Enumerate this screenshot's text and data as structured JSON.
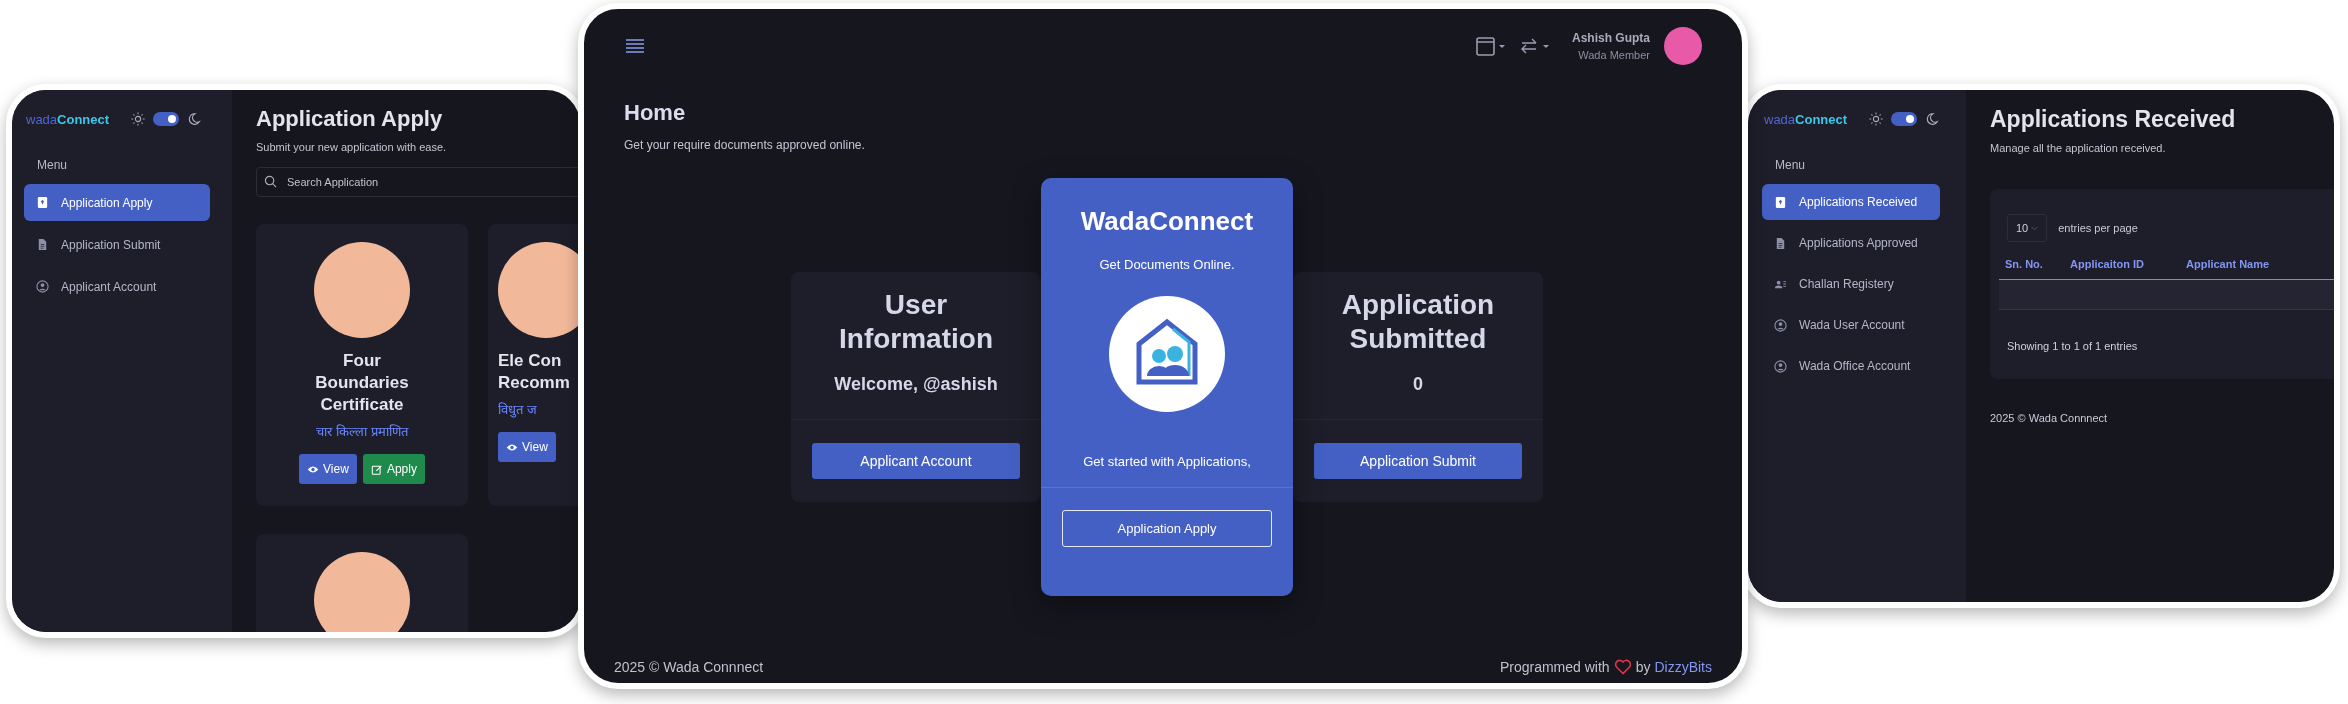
{
  "apply_screen": {
    "logo": {
      "prefix": "wada",
      "name": "Connect"
    },
    "theme_toggle": {
      "on": true
    },
    "menu_label": "Menu",
    "sidebar": {
      "items": [
        {
          "kind": "upload",
          "label": "Application Apply",
          "selected": true
        },
        {
          "kind": "document",
          "label": "Application Submit",
          "selected": false
        },
        {
          "kind": "account",
          "label": "Applicant Account",
          "selected": false
        }
      ]
    },
    "title": "Application Apply",
    "subtitle": "Submit your new application with ease.",
    "search": {
      "placeholder": "Search Application"
    },
    "cards": [
      {
        "kind": "full",
        "title": "Four Boundaries Certificate",
        "subtitle": "चार किल्ला प्रमाणित",
        "buttons": [
          {
            "kind": "view",
            "label": "View"
          },
          {
            "kind": "apply",
            "label": "Apply"
          }
        ]
      },
      {
        "kind": "partial",
        "title": "Ele Con Recomm",
        "subtitle": "विधुत ज",
        "buttons": [
          {
            "kind": "view",
            "label": "View"
          }
        ]
      },
      {
        "kind": "image"
      }
    ]
  },
  "home_screen": {
    "topbar": {
      "user_name": "Ashish Gupta",
      "user_role": "Wada Member"
    },
    "title": "Home",
    "subtitle": "Get your require documents approved online.",
    "cards": [
      {
        "kind": "info",
        "title": "User Information",
        "text": "Welcome, @ashish",
        "button": "Applicant Account"
      },
      {
        "kind": "feature",
        "title": "WadaConnect",
        "text": "Get Documents Online.",
        "note": "Get started with Applications,",
        "button": "Application Apply"
      },
      {
        "kind": "info",
        "title": "Application Submitted",
        "text": "0",
        "button": "Application Submit"
      }
    ],
    "footer": {
      "copyright": "2025 © Wada Connnect",
      "credit": "Programmed with",
      "by": "by",
      "link": "DizzyBits"
    }
  },
  "received_screen": {
    "logo": {
      "prefix": "wada",
      "name": "Connect"
    },
    "theme_toggle": {
      "on": true
    },
    "menu_label": "Menu",
    "sidebar": {
      "items": [
        {
          "kind": "upload",
          "label": "Applications Received",
          "selected": true
        },
        {
          "kind": "document",
          "label": "Applications Approved",
          "selected": false
        },
        {
          "kind": "people",
          "label": "Challan Registery",
          "selected": false
        },
        {
          "kind": "account",
          "label": "Wada User Account",
          "selected": false
        },
        {
          "kind": "account",
          "label": "Wada Office Account",
          "selected": false
        }
      ]
    },
    "title": "Applications Received",
    "subtitle": "Manage all the application received.",
    "table": {
      "page_size": "10",
      "page_size_label": "entries per page",
      "columns": [
        "Sn. No.",
        "Applicaiton ID",
        "Applicant Name"
      ],
      "info": "Showing 1 to 1 of 1 entries"
    },
    "footer": "2025 © Wada Connnect"
  }
}
